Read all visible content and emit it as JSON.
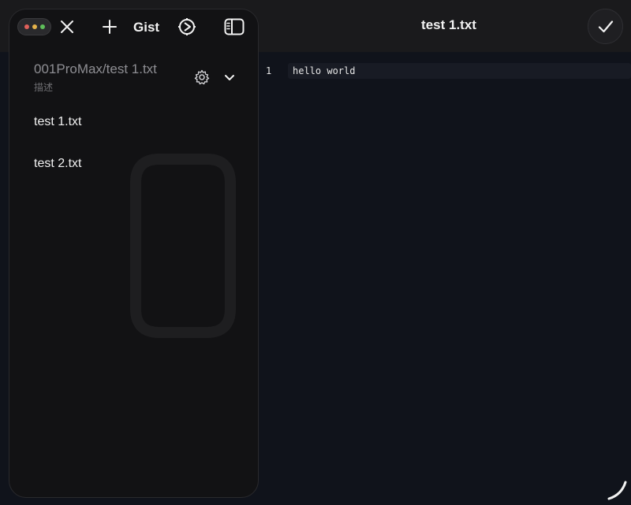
{
  "sidebar": {
    "toolbar": {
      "gist_label": "Gist"
    },
    "repo": {
      "title": "001ProMax/test 1.txt",
      "description": "描述"
    },
    "files": [
      {
        "name": "test 1.txt"
      },
      {
        "name": "test 2.txt"
      }
    ]
  },
  "editor": {
    "title": "test 1.txt",
    "lines": [
      {
        "number": "1",
        "text": "hello world"
      }
    ]
  },
  "colors": {
    "dot_red": "#e0605a",
    "dot_yellow": "#e4b24a",
    "dot_green": "#5fbf5a"
  },
  "icons": [
    "close-icon",
    "plus-icon",
    "sync-icon",
    "sidebar-toggle-icon",
    "gear-icon",
    "chevron-down-icon",
    "checkmark-icon",
    "resize-handle-icon"
  ]
}
